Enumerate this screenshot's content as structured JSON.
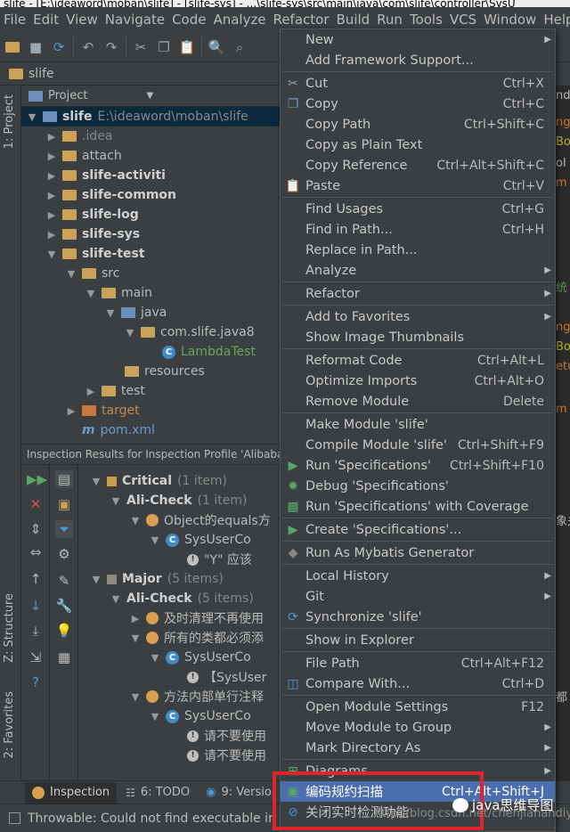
{
  "title": "slife - [E:\\ideaword\\moban\\slife] - [slife-sys] - ...\\slife-sys\\src\\main\\java\\com\\slife\\controller\\SysU",
  "menubar": [
    "File",
    "Edit",
    "View",
    "Navigate",
    "Code",
    "Analyze",
    "Refactor",
    "Build",
    "Run",
    "Tools",
    "VCS",
    "Window",
    "Help"
  ],
  "breadcrumb": "slife",
  "left_tabs": {
    "project": "1: Project",
    "structure": "Z: Structure",
    "favorites": "2: Favorites"
  },
  "project_header": "Project",
  "tree": [
    {
      "label": "slife",
      "path": "E:\\ideaword\\moban\\slife"
    },
    {
      "label": ".idea"
    },
    {
      "label": "attach"
    },
    {
      "label": "slife-activiti"
    },
    {
      "label": "slife-common"
    },
    {
      "label": "slife-log"
    },
    {
      "label": "slife-sys"
    },
    {
      "label": "slife-test"
    },
    {
      "label": "src"
    },
    {
      "label": "main"
    },
    {
      "label": "java"
    },
    {
      "label": "com.slife.java8"
    },
    {
      "label": "LambdaTest"
    },
    {
      "label": "resources"
    },
    {
      "label": "test"
    },
    {
      "label": "target"
    },
    {
      "label": "pom.xml"
    }
  ],
  "inspection": {
    "title": "Inspection Results for Inspection Profile 'Alibaba Co",
    "rows": [
      {
        "label": "Critical",
        "count": "(1 item)"
      },
      {
        "label": "Ali-Check",
        "count": "(1 item)"
      },
      {
        "label": "Object的equals方"
      },
      {
        "label": "SysUserCo"
      },
      {
        "label": "\"Y\" 应该"
      },
      {
        "label": "Major",
        "count": "(5 items)"
      },
      {
        "label": "Ali-Check",
        "count": "(5 items)"
      },
      {
        "label": "及时清理不再使用"
      },
      {
        "label": "所有的类都必须添"
      },
      {
        "label": "SysUserCo"
      },
      {
        "label": "【SysUser"
      },
      {
        "label": "方法内部单行注释"
      },
      {
        "label": "SysUserCo"
      },
      {
        "label": "请不要使用"
      },
      {
        "label": "请不要使用"
      }
    ]
  },
  "editor_fragments": [
    "nd",
    "ng",
    "Bo",
    "ol",
    "m",
    "统",
    "ng",
    "Bo",
    "etu",
    "m",
    "象关",
    "都"
  ],
  "bottom_tabs": [
    {
      "label": "Inspection",
      "active": true
    },
    {
      "label": "6: TODO"
    },
    {
      "label": "9: Versio"
    }
  ],
  "status": "Throwable: Could not find executable in",
  "context_menu": [
    {
      "label": "New",
      "shortcut": "",
      "submenu": true
    },
    {
      "label": "Add Framework Support...",
      "shortcut": ""
    },
    {
      "sep": true
    },
    {
      "label": "Cut",
      "shortcut": "Ctrl+X",
      "icon": "cut-icon"
    },
    {
      "label": "Copy",
      "shortcut": "Ctrl+C",
      "icon": "copy-icon"
    },
    {
      "label": "Copy Path",
      "shortcut": "Ctrl+Shift+C"
    },
    {
      "label": "Copy as Plain Text",
      "shortcut": ""
    },
    {
      "label": "Copy Reference",
      "shortcut": "Ctrl+Alt+Shift+C"
    },
    {
      "label": "Paste",
      "shortcut": "Ctrl+V",
      "icon": "paste-icon"
    },
    {
      "sep": true
    },
    {
      "label": "Find Usages",
      "shortcut": "Ctrl+G"
    },
    {
      "label": "Find in Path...",
      "shortcut": "Ctrl+H"
    },
    {
      "label": "Replace in Path...",
      "shortcut": ""
    },
    {
      "label": "Analyze",
      "shortcut": "",
      "submenu": true
    },
    {
      "sep": true
    },
    {
      "label": "Refactor",
      "shortcut": "",
      "submenu": true
    },
    {
      "sep": true
    },
    {
      "label": "Add to Favorites",
      "shortcut": "",
      "submenu": true
    },
    {
      "label": "Show Image Thumbnails",
      "shortcut": ""
    },
    {
      "sep": true
    },
    {
      "label": "Reformat Code",
      "shortcut": "Ctrl+Alt+L"
    },
    {
      "label": "Optimize Imports",
      "shortcut": "Ctrl+Alt+O"
    },
    {
      "label": "Remove Module",
      "shortcut": "Delete"
    },
    {
      "sep": true
    },
    {
      "label": "Make Module 'slife'",
      "shortcut": ""
    },
    {
      "label": "Compile Module 'slife'",
      "shortcut": "Ctrl+Shift+F9"
    },
    {
      "label": "Run 'Specifications'",
      "shortcut": "Ctrl+Shift+F10",
      "icon": "run-icon"
    },
    {
      "label": "Debug 'Specifications'",
      "shortcut": "",
      "icon": "debug-icon"
    },
    {
      "label": "Run 'Specifications' with Coverage",
      "shortcut": "",
      "icon": "coverage-icon"
    },
    {
      "sep": true
    },
    {
      "label": "Create 'Specifications'...",
      "shortcut": "",
      "icon": "run-icon"
    },
    {
      "sep": true
    },
    {
      "label": "Run As Mybatis Generator",
      "shortcut": "",
      "icon": "mybatis-icon"
    },
    {
      "sep": true
    },
    {
      "label": "Local History",
      "shortcut": "",
      "submenu": true
    },
    {
      "label": "Git",
      "shortcut": "",
      "submenu": true
    },
    {
      "label": "Synchronize 'slife'",
      "shortcut": "",
      "icon": "sync-icon"
    },
    {
      "sep": true
    },
    {
      "label": "Show in Explorer",
      "shortcut": ""
    },
    {
      "sep": true
    },
    {
      "label": "File Path",
      "shortcut": "Ctrl+Alt+F12"
    },
    {
      "label": "Compare With...",
      "shortcut": "Ctrl+D",
      "icon": "compare-icon"
    },
    {
      "sep": true
    },
    {
      "label": "Open Module Settings",
      "shortcut": "F12"
    },
    {
      "label": "Move Module to Group",
      "shortcut": "",
      "submenu": true
    },
    {
      "label": "Mark Directory As",
      "shortcut": "",
      "submenu": true
    },
    {
      "sep": true
    },
    {
      "label": "Diagrams",
      "shortcut": "",
      "submenu": true,
      "icon": "diagram-icon"
    },
    {
      "label": "编码规约扫描",
      "shortcut": "Ctrl+Alt+Shift+J",
      "icon": "scan-icon",
      "highlight": true
    },
    {
      "label": "关闭实时检测功能",
      "shortcut": "",
      "icon": "realtime-icon"
    }
  ],
  "watermark": "java思维导图",
  "csdn_watermark": "http://blog.csdn.net/chenjianandiyi",
  "colors": {
    "bg": "#3c3f41",
    "highlight": "#4b6eaf",
    "redbox": "#e0242b"
  }
}
